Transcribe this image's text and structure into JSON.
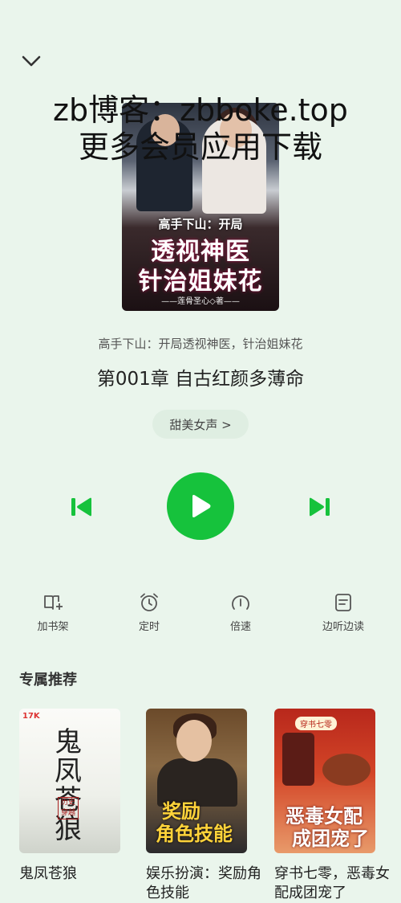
{
  "player": {
    "book_name": "高手下山：开局透视神医，针治姐妹花",
    "chapter": "第001章 自古红颜多薄命",
    "voice_label": "甜美女声 >"
  },
  "cover": {
    "title_line1": "高手下山：开局",
    "title_line2": "透视神医",
    "title_line3": "针治姐妹花",
    "author": "——莲骨圣心◇著——"
  },
  "watermark": {
    "line1": "zb博客：zbboke.top",
    "line2": "更多会员应用下载"
  },
  "toolbar": [
    {
      "label": "加书架",
      "icon": "add-to-shelf-icon"
    },
    {
      "label": "定时",
      "icon": "alarm-clock-icon"
    },
    {
      "label": "倍速",
      "icon": "speed-gauge-icon"
    },
    {
      "label": "边听边读",
      "icon": "read-along-icon"
    }
  ],
  "recommend": {
    "title": "专属推荐",
    "books": [
      {
        "title": "鬼凤苍狼",
        "cover_text": "鬼凤苍狼",
        "cover_logo": "17K",
        "cover_seal": "历史穿越"
      },
      {
        "title": "娱乐扮演：奖励角色技能",
        "cover_line1": "奖励",
        "cover_line2": "角色技能"
      },
      {
        "title": "穿书七零，恶毒女配成团宠了",
        "cover_tag": "穿书七零",
        "cover_line1": "恶毒女配",
        "cover_line2": "成团宠了"
      }
    ]
  },
  "colors": {
    "accent": "#16c23c",
    "background": "#eaf5ec"
  }
}
